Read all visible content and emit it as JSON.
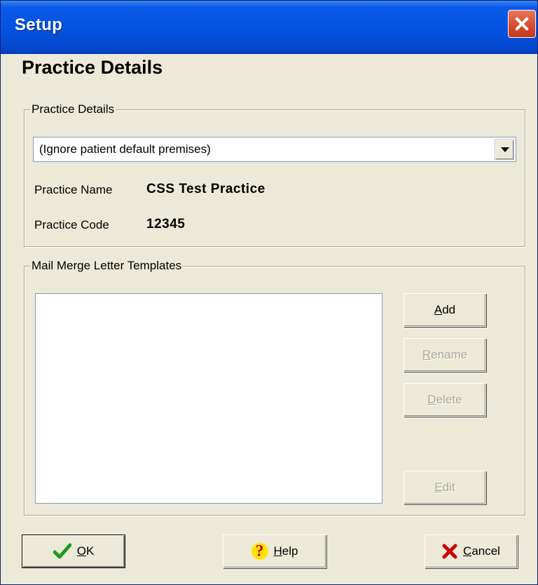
{
  "window": {
    "title": "Setup"
  },
  "heading": "Practice Details",
  "practice_group": {
    "legend": "Practice Details",
    "premises_select": {
      "value": "(Ignore patient default premises)"
    },
    "name_label": "Practice Name",
    "name_value": "CSS Test Practice",
    "code_label": "Practice Code",
    "code_value": "12345"
  },
  "templates_group": {
    "legend": "Mail Merge Letter Templates",
    "items": [],
    "buttons": {
      "add": {
        "mnemonic": "A",
        "rest": "dd"
      },
      "rename": {
        "mnemonic": "R",
        "rest": "ename"
      },
      "delete": {
        "mnemonic": "D",
        "rest": "elete"
      },
      "edit": {
        "mnemonic": "E",
        "rest": "dit"
      }
    }
  },
  "footer": {
    "ok": {
      "mnemonic": "O",
      "rest": "K"
    },
    "help": {
      "mnemonic": "H",
      "rest": "elp"
    },
    "cancel": {
      "mnemonic": "C",
      "rest": "ancel"
    }
  },
  "icons": {
    "close": "close-icon",
    "ok": "checkmark-icon",
    "help": "question-mark-icon",
    "cancel": "red-x-icon"
  },
  "colors": {
    "titlebar": "#0553e0",
    "dialog_bg": "#ece9d8",
    "close_button": "#d44a2a",
    "ok_check": "#1e9a1e",
    "cancel_x": "#cc0000"
  }
}
